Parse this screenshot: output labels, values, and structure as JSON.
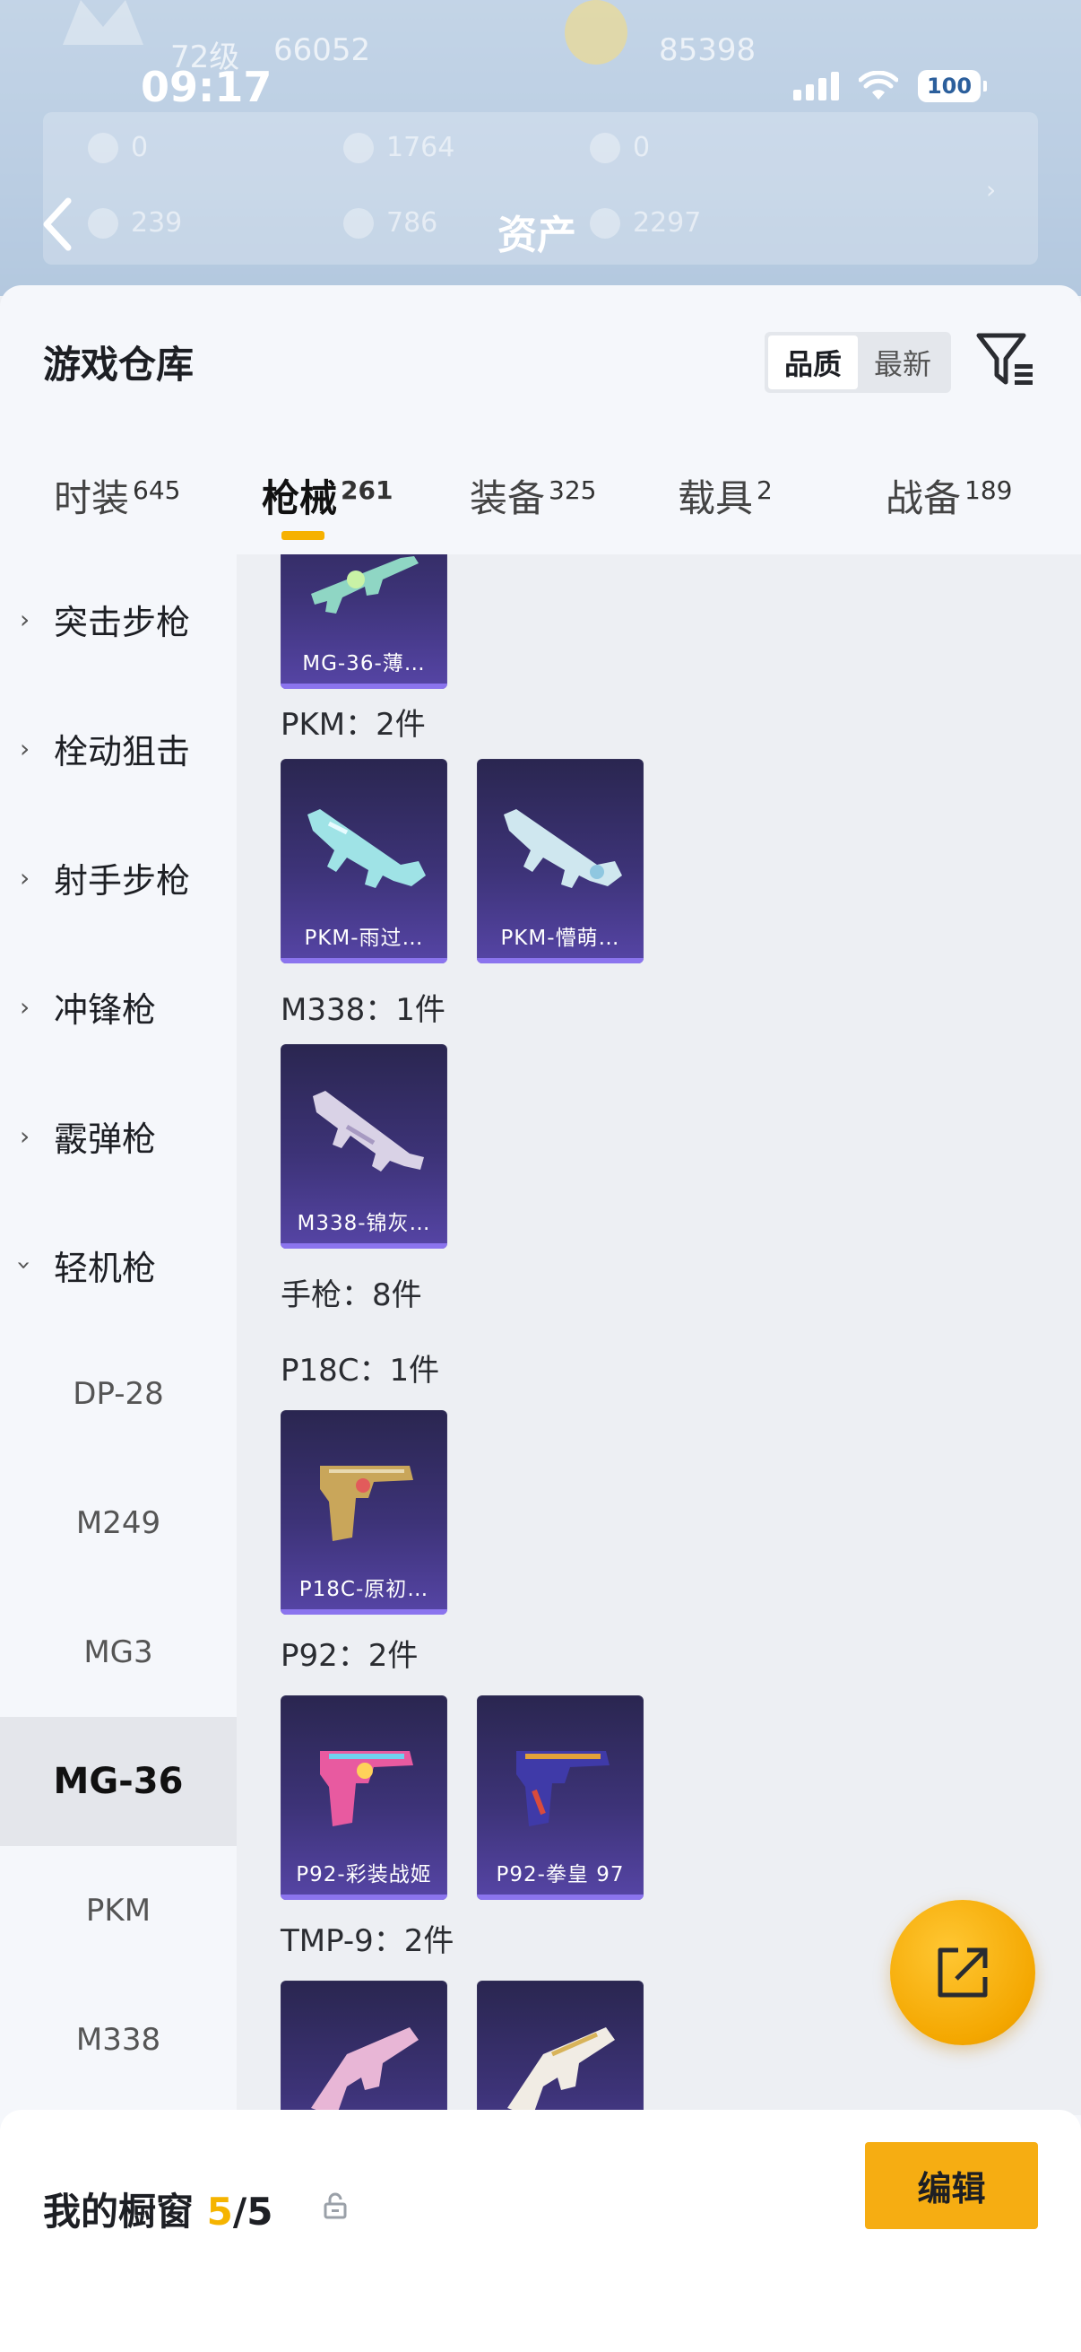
{
  "status_bar": {
    "time": "09:17",
    "battery": "100"
  },
  "profile": {
    "level": "72级",
    "coin_a": "66052",
    "coin_b": "85398"
  },
  "assets": {
    "row1": [
      "0",
      "1764",
      "0"
    ],
    "row2": [
      "239",
      "786",
      "2297"
    ]
  },
  "nav": {
    "title": "资产"
  },
  "sheet": {
    "title": "游戏仓库",
    "sort": {
      "options": [
        "品质",
        "最新"
      ],
      "selected": "品质"
    }
  },
  "tabs": [
    {
      "label": "时装",
      "count": "645"
    },
    {
      "label": "枪械",
      "count": "261",
      "active": true
    },
    {
      "label": "装备",
      "count": "325"
    },
    {
      "label": "载具",
      "count": "2"
    },
    {
      "label": "战备",
      "count": "189"
    }
  ],
  "sidebar": {
    "categories": [
      "突击步枪",
      "栓动狙击",
      "射手步枪",
      "冲锋枪",
      "霰弹枪",
      "轻机枪"
    ],
    "subitems": [
      "DP-28",
      "M249",
      "MG3",
      "MG-36",
      "PKM",
      "M338"
    ],
    "active_subitem": "MG-36"
  },
  "content": {
    "groups": [
      {
        "label": "PKM：2件"
      },
      {
        "label": "M338：1件"
      },
      {
        "label": "手枪：8件"
      },
      {
        "label": "P18C：1件"
      },
      {
        "label": "P92：2件"
      },
      {
        "label": "TMP-9：2件"
      }
    ],
    "cards": [
      {
        "name": "MG-36-薄…",
        "weapon": "rifle-green-icon"
      },
      {
        "name": "PKM-雨过…",
        "weapon": "machine-gun-cyan-icon"
      },
      {
        "name": "PKM-懵萌…",
        "weapon": "machine-gun-white-icon"
      },
      {
        "name": "M338-锦灰…",
        "weapon": "rifle-grey-icon"
      },
      {
        "name": "P18C-原初…",
        "weapon": "pistol-gold-icon"
      },
      {
        "name": "P92-彩装战姬",
        "weapon": "pistol-pink-icon"
      },
      {
        "name": "P92-拳皇 97",
        "weapon": "pistol-purple-icon"
      },
      {
        "name": "",
        "weapon": "smg-pink-icon"
      },
      {
        "name": "",
        "weapon": "smg-white-icon"
      }
    ]
  },
  "bottom": {
    "showcase_label": "我的橱窗",
    "showcase_count": "5",
    "showcase_total": "/5",
    "edit_label": "编辑"
  },
  "colors": {
    "accent": "#f6ad12",
    "card_bg": "#3d3378",
    "indicator": "#f6b100"
  }
}
